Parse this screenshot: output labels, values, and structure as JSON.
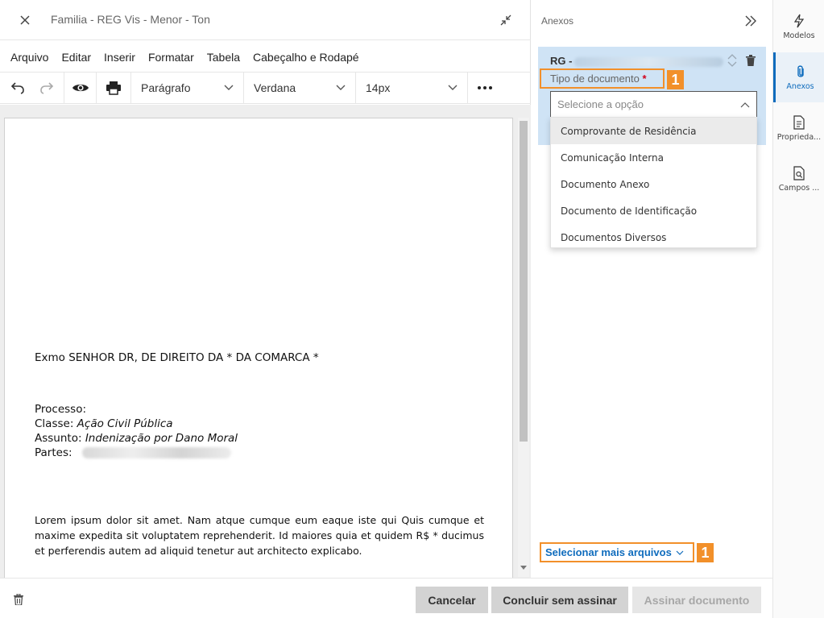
{
  "editor": {
    "title": "Familia - REG Vis - Menor - Ton",
    "menu": [
      "Arquivo",
      "Editar",
      "Inserir",
      "Formatar",
      "Tabela",
      "Cabeçalho e Rodapé"
    ],
    "toolbar": {
      "paragraph_style": "Parágrafo",
      "font_family": "Verdana",
      "font_size": "14px"
    },
    "document": {
      "greeting": "Exmo SENHOR DR, DE DIREITO DA * DA COMARCA *",
      "processo_label": "Processo:",
      "classe_label": "Classe:",
      "classe_value": "Ação Civil Pública",
      "assunto_label": "Assunto:",
      "assunto_value": "Indenização por Dano Moral",
      "partes_label": "Partes:",
      "body": "Lorem ipsum dolor sit amet.   Nam atque cumque eum eaque iste qui Quis cumque et maxime expedita sit voluptatem reprehenderit. Id maiores quia et quidem R$ * ducimus et perferendis autem ad aliquid tenetur aut architecto explicabo."
    }
  },
  "panel": {
    "title": "Anexos",
    "attachment": {
      "name_prefix": "RG -",
      "doc_type_label": "Tipo de documento",
      "required_mark": "*",
      "select_placeholder": "Selecione a opção",
      "options": [
        "Comprovante de Residência",
        "Comunicação Interna",
        "Documento Anexo",
        "Documento de Identificação",
        "Documentos Diversos"
      ]
    },
    "more_files_link": "Selecionar mais arquivos",
    "badge_text": "1"
  },
  "footer": {
    "cancel": "Cancelar",
    "finish_no_sign": "Concluir sem assinar",
    "sign": "Assinar documento"
  },
  "rail": {
    "items": [
      "Modelos",
      "Anexos",
      "Proprieda...",
      "Campos ..."
    ]
  },
  "colors": {
    "accent": "#0f6cbd",
    "highlight": "#f2902a",
    "card_bg": "#cfe3f5"
  }
}
